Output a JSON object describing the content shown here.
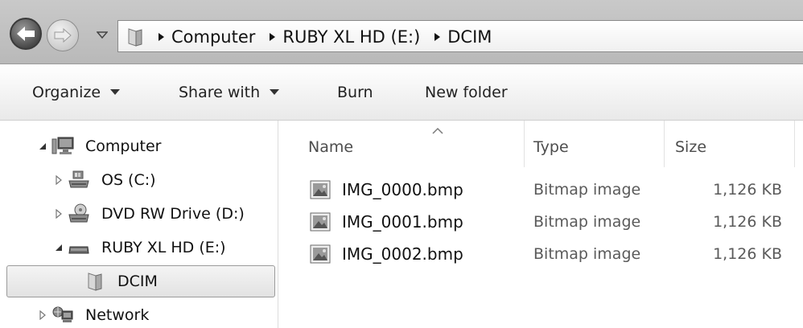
{
  "address_bar": {
    "breadcrumbs": [
      "Computer",
      "RUBY XL HD (E:)",
      "DCIM"
    ]
  },
  "toolbar": {
    "organize_label": "Organize",
    "share_label": "Share with",
    "burn_label": "Burn",
    "new_folder_label": "New folder"
  },
  "nav_tree": {
    "computer": "Computer",
    "os_drive": "OS (C:)",
    "dvd_drive": "DVD RW Drive (D:)",
    "ruby_drive": "RUBY XL HD (E:)",
    "dcim": "DCIM",
    "network": "Network"
  },
  "columns": {
    "name": "Name",
    "type": "Type",
    "size": "Size"
  },
  "files": [
    {
      "name": "IMG_0000.bmp",
      "type": "Bitmap image",
      "size": "1,126 KB"
    },
    {
      "name": "IMG_0001.bmp",
      "type": "Bitmap image",
      "size": "1,126 KB"
    },
    {
      "name": "IMG_0002.bmp",
      "type": "Bitmap image",
      "size": "1,126 KB"
    }
  ],
  "icons": {
    "back": "back-arrow-icon",
    "forward": "forward-arrow-icon",
    "folder": "folder-icon",
    "computer": "computer-icon",
    "drive": "hard-drive-icon",
    "dvd": "dvd-drive-icon",
    "removable": "removable-drive-icon",
    "network": "network-icon",
    "bitmap": "bitmap-file-icon"
  },
  "colors": {
    "chrome_bg": "#bdbdbd",
    "selection": "#e6e6e6",
    "secondary_text": "#5a5a5a"
  }
}
